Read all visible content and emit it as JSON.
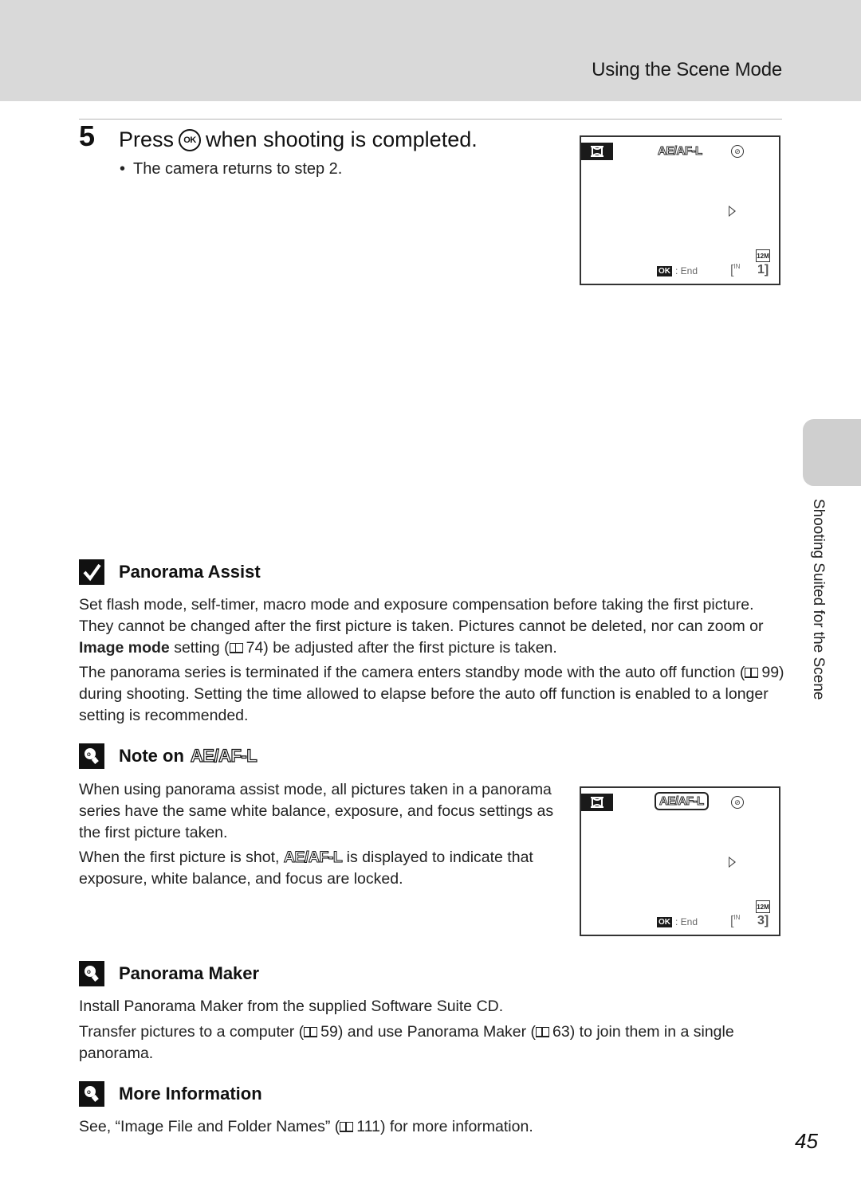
{
  "header": {
    "section_title": "Using the Scene Mode"
  },
  "step": {
    "number": "5",
    "title_before": "Press",
    "ok_icon": "OK",
    "title_after": "when shooting is completed.",
    "bullet": "The camera returns to step 2."
  },
  "screens": [
    {
      "mode_icon": "⌘",
      "aeaf_label": "AE/AF-L",
      "aeaf_boxed": false,
      "flash_icon": "⚡",
      "ok_label": "OK",
      "end_label": ": End",
      "image_size": "12M",
      "memory_icon": "[",
      "memory_sup": "IN",
      "count": "1]"
    },
    {
      "mode_icon": "⌘",
      "aeaf_label": "AE/AF-L",
      "aeaf_boxed": true,
      "flash_icon": "⚡",
      "ok_label": "OK",
      "end_label": ": End",
      "image_size": "12M",
      "memory_icon": "[",
      "memory_sup": "IN",
      "count": "3]"
    }
  ],
  "panorama_assist": {
    "title": "Panorama Assist",
    "p1_a": "Set flash mode, self-timer, macro mode and exposure compensation before taking the first picture. They cannot be changed after the first picture is taken. Pictures cannot be deleted, nor can zoom or ",
    "p1_bold": "Image mode",
    "p1_b": " setting (",
    "p1_ref": "74",
    "p1_c": ") be adjusted after the first picture is taken.",
    "p2_a": "The panorama series is terminated if the camera enters standby mode with the auto off function (",
    "p2_ref": "99",
    "p2_b": ") during shooting. Setting the time allowed to elapse before the auto off function is enabled to a longer setting is recommended."
  },
  "note_aeaf": {
    "title": "Note on",
    "title_symbol": "AE/AF-L",
    "p1": "When using panorama assist mode, all pictures taken in a panorama series have the same white balance, exposure, and focus settings as the first picture taken.",
    "p2_a": "When the first picture is shot, ",
    "p2_symbol": "AE/AF-L",
    "p2_b": " is displayed to indicate that exposure, white balance, and focus are locked."
  },
  "panorama_maker": {
    "title": "Panorama Maker",
    "p1": "Install Panorama Maker from the supplied Software Suite CD.",
    "p2_a": "Transfer pictures to a computer (",
    "p2_ref1": "59",
    "p2_b": ") and use Panorama Maker (",
    "p2_ref2": "63",
    "p2_c": ") to join them in a single panorama."
  },
  "more_info": {
    "title": "More Information",
    "p1_a": "See, “Image File and Folder Names” (",
    "p1_ref": "111",
    "p1_b": ") for more information."
  },
  "side_tab": {
    "label": "Shooting Suited for the Scene"
  },
  "page_number": "45"
}
